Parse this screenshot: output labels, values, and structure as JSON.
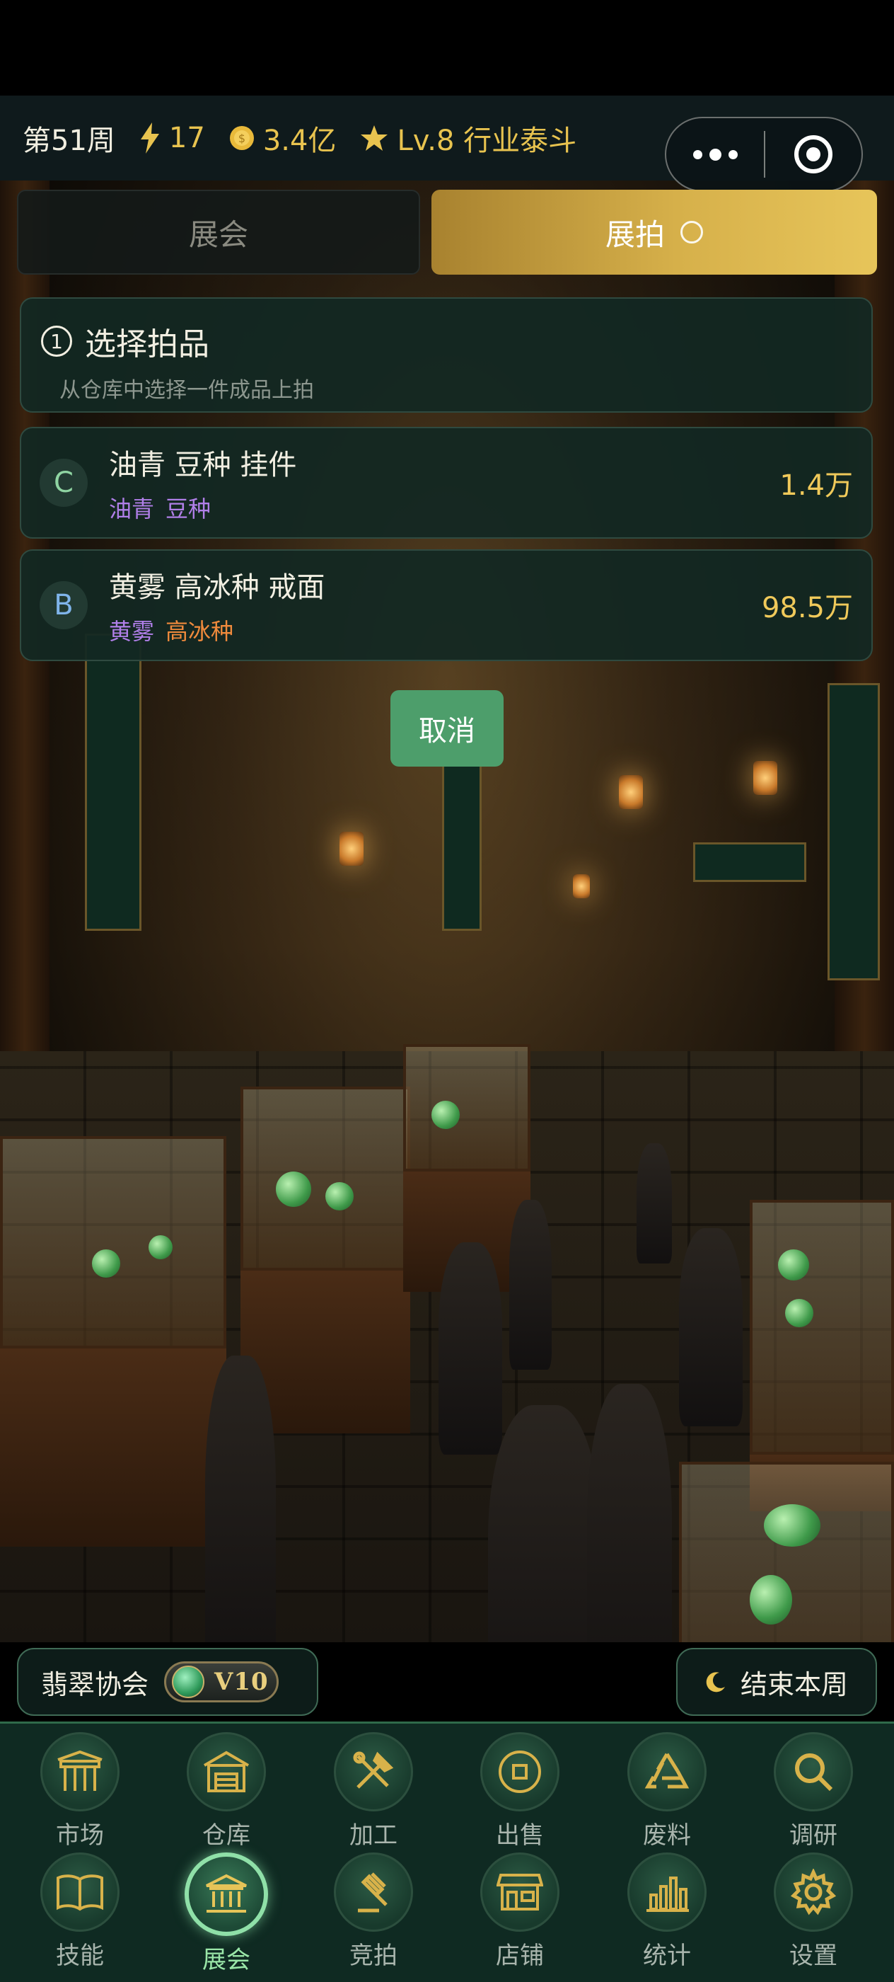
{
  "status": {
    "week": "第51周",
    "energy": "17",
    "money": "3.4亿",
    "level": "Lv.8 行业泰斗"
  },
  "tabs": [
    {
      "label": "展会",
      "active": false
    },
    {
      "label": "展拍",
      "active": true
    }
  ],
  "step": {
    "number": "1",
    "title": "选择拍品",
    "subtitle": "从仓库中选择一件成品上拍"
  },
  "items": [
    {
      "grade": "C",
      "name": "油青 豆种 挂件",
      "tags": [
        "油青",
        "豆种"
      ],
      "price": "1.4万"
    },
    {
      "grade": "B",
      "name": "黄雾 高冰种 戒面",
      "tags": [
        "黄雾",
        "高冰种"
      ],
      "price": "98.5万"
    }
  ],
  "cancel_label": "取消",
  "association": {
    "label": "翡翠协会",
    "vip": "V10"
  },
  "end_week_label": "结束本周",
  "nav": {
    "row1": [
      "市场",
      "仓库",
      "加工",
      "出售",
      "废料",
      "调研"
    ],
    "row2": [
      "技能",
      "展会",
      "竞拍",
      "店铺",
      "统计",
      "设置"
    ],
    "active": "展会"
  },
  "colors": {
    "gold": "#e8c34f",
    "accent_green": "#4d9e6b",
    "nav_active": "#8fe0a8",
    "tag_purple": "#b07fe8",
    "tag_orange": "#f08a3c"
  }
}
